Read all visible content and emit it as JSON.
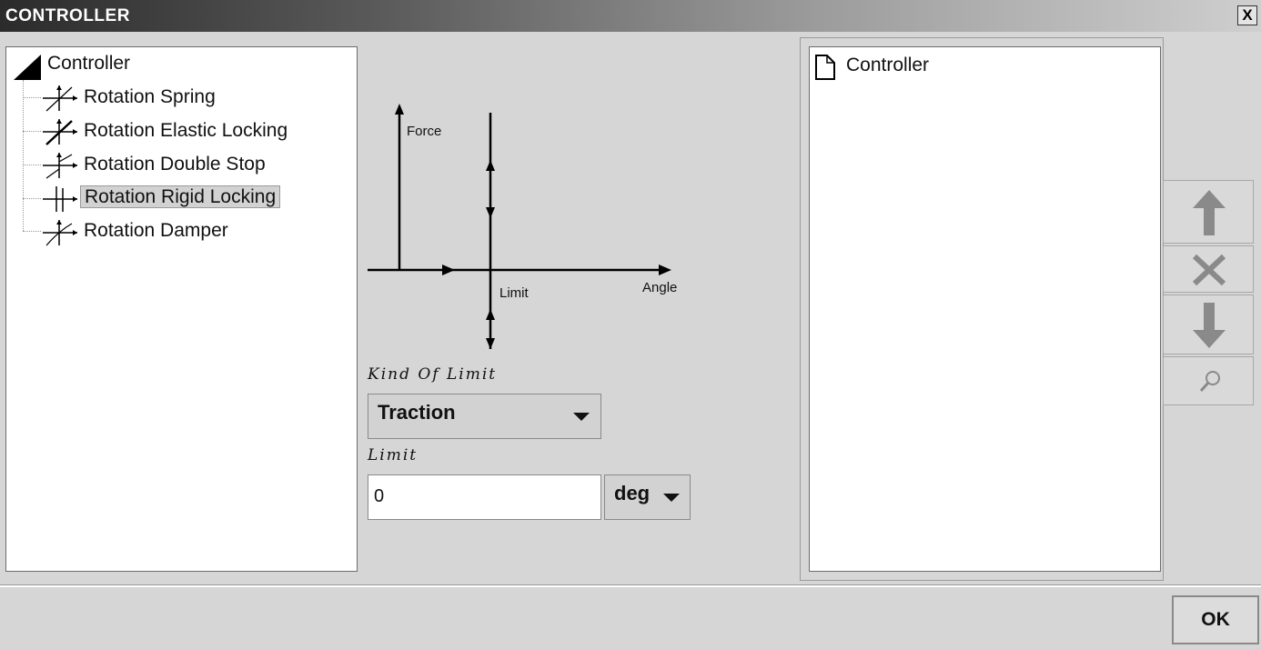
{
  "window": {
    "title": "CONTROLLER",
    "close_glyph": "X"
  },
  "tree": {
    "root": {
      "label": "Controller",
      "icon": "folder-triangle-icon"
    },
    "items": [
      {
        "label": "Rotation Spring",
        "icon": "rotation-spring-icon",
        "selected": false
      },
      {
        "label": "Rotation Elastic Locking",
        "icon": "rotation-elastic-locking-icon",
        "selected": false
      },
      {
        "label": "Rotation Double Stop",
        "icon": "rotation-double-stop-icon",
        "selected": false
      },
      {
        "label": "Rotation Rigid Locking",
        "icon": "rotation-rigid-locking-icon",
        "selected": true
      },
      {
        "label": "Rotation Damper",
        "icon": "rotation-damper-icon",
        "selected": false
      }
    ]
  },
  "diagram": {
    "force_label": "Force",
    "limit_label": "Limit",
    "angle_label": "Angle"
  },
  "form": {
    "kind_label": "Kind Of Limit",
    "kind_value": "Traction",
    "limit_label": "Limit",
    "limit_value": "0",
    "unit_value": "deg"
  },
  "list": {
    "items": [
      {
        "label": "Controller",
        "icon": "document-icon"
      }
    ]
  },
  "side_buttons": [
    {
      "name": "move-up-button",
      "icon": "arrow-up-icon"
    },
    {
      "name": "delete-button",
      "icon": "delete-x-icon"
    },
    {
      "name": "move-down-button",
      "icon": "arrow-down-icon"
    },
    {
      "name": "inspect-button",
      "icon": "magnifier-icon"
    }
  ],
  "ok_label": "OK"
}
